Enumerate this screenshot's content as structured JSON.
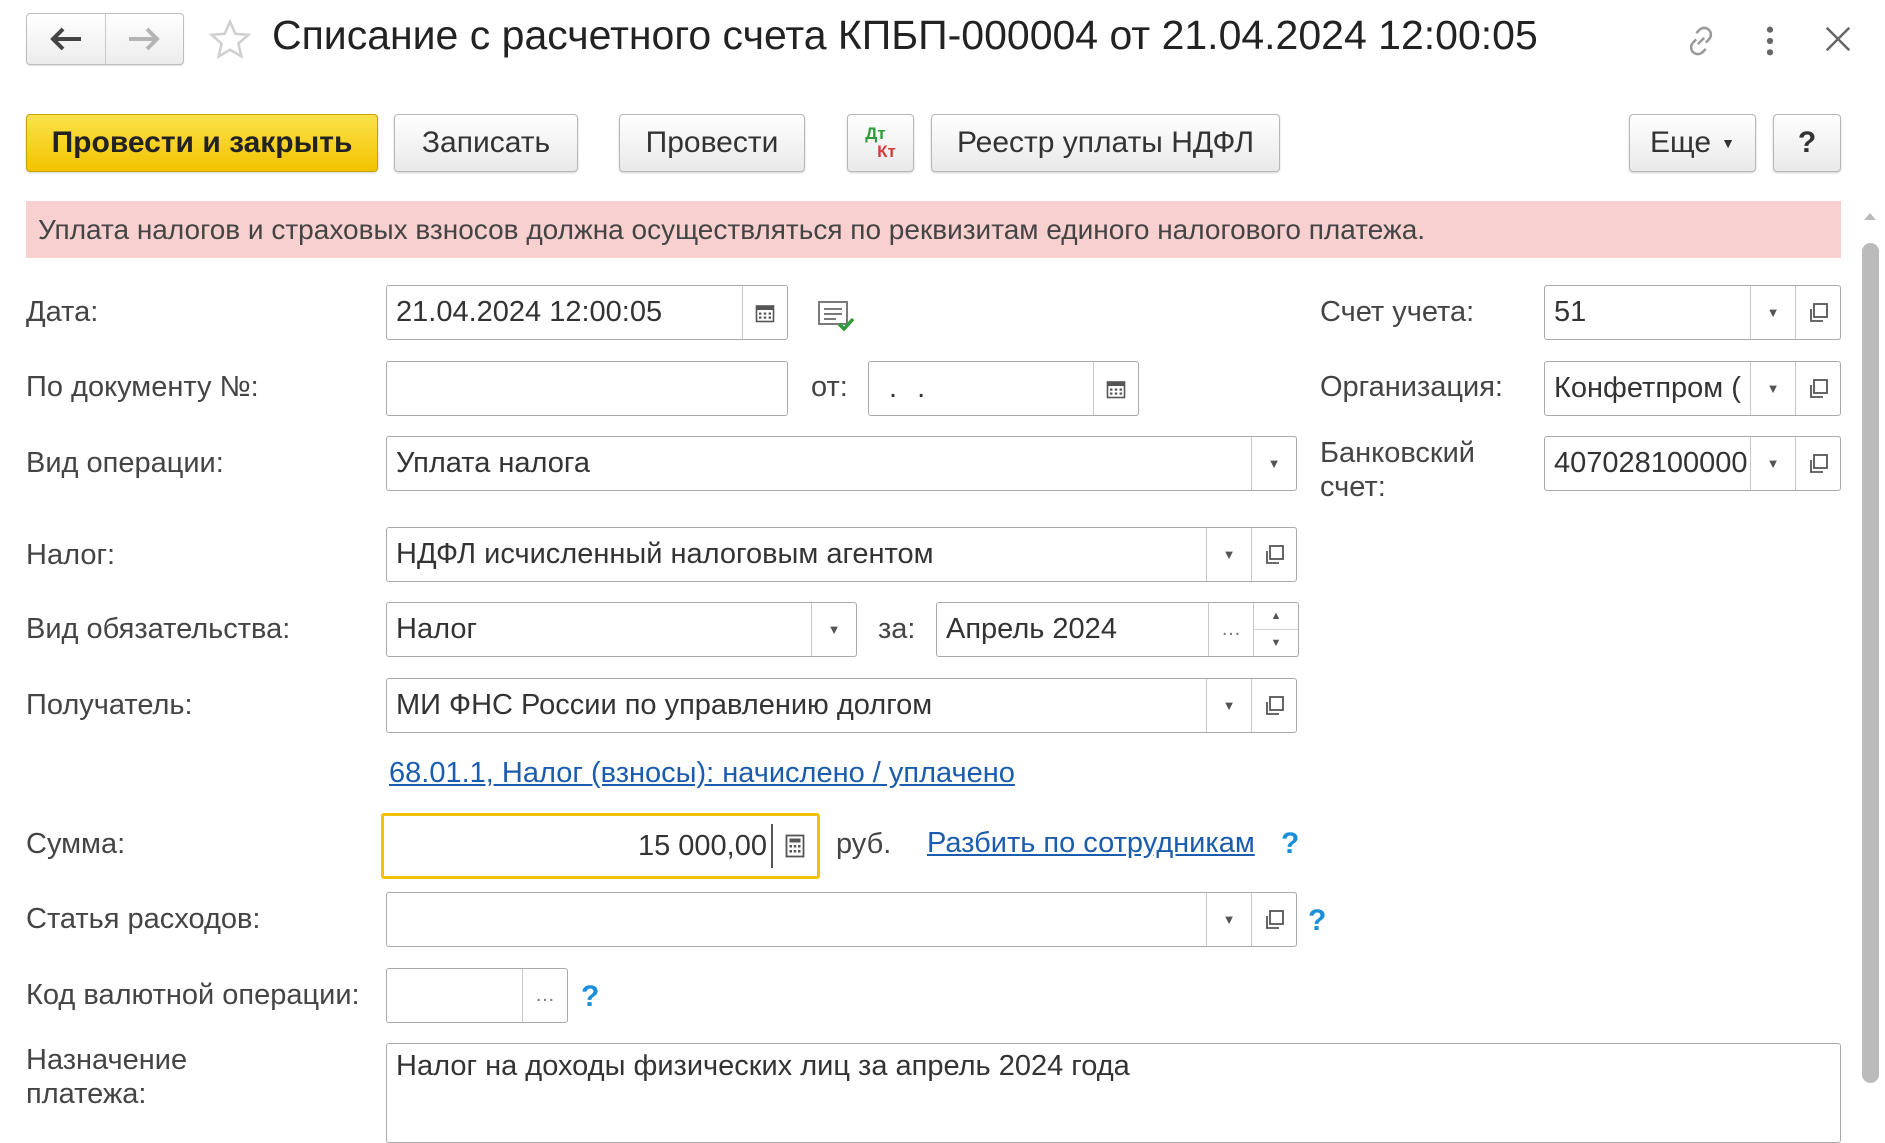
{
  "window": {
    "title": "Списание с расчетного счета КПБП-000004 от 21.04.2024 12:00:05"
  },
  "toolbar": {
    "post_close": "Провести и закрыть",
    "save": "Записать",
    "post": "Провести",
    "dtkt_top": "Дт",
    "dtkt_bottom": "Кт",
    "registry": "Реестр уплаты НДФЛ",
    "more": "Еще",
    "help": "?"
  },
  "warning": "Уплата налогов и страховых взносов должна осуществляться по реквизитам единого налогового платежа.",
  "form": {
    "date_label": "Дата:",
    "date_value": "21.04.2024 12:00:05",
    "doc_no_label": "По документу №:",
    "doc_no_value": "",
    "from_label": "от:",
    "from_value": " .  .",
    "operation_label": "Вид операции:",
    "operation_value": "Уплата налога",
    "tax_label": "Налог:",
    "tax_value": "НДФЛ исчисленный налоговым агентом",
    "obligation_label": "Вид обязательства:",
    "obligation_value": "Налог",
    "for_label": "за:",
    "period_value": "Апрель 2024",
    "recipient_label": "Получатель:",
    "recipient_value": "МИ ФНС России по управлению долгом",
    "account_link": "68.01.1, Налог (взносы): начислено / уплачено",
    "sum_label": "Сумма:",
    "sum_value": "15 000,00",
    "currency": "руб.",
    "split_link": "Разбить по сотрудникам",
    "expense_label": "Статья расходов:",
    "expense_value": "",
    "currency_op_label": "Код валютной операции:",
    "currency_op_value": "",
    "purpose_label_1": "Назначение",
    "purpose_label_2": "платежа:",
    "purpose_value": "Налог на доходы физических лиц за апрель 2024 года",
    "account_label": "Счет учета:",
    "account_value": "51",
    "org_label": "Организация:",
    "org_value": "Конфетпром (",
    "bank_label_1": "Банковский",
    "bank_label_2": "счет:",
    "bank_value": "407028100000",
    "help_mark": "?"
  },
  "colors": {
    "primary_button": "#f2c300",
    "warning_bg": "#f8d0d0",
    "link": "#1a5cad",
    "help": "#1a8fd8",
    "focus_border": "#f2c200"
  }
}
